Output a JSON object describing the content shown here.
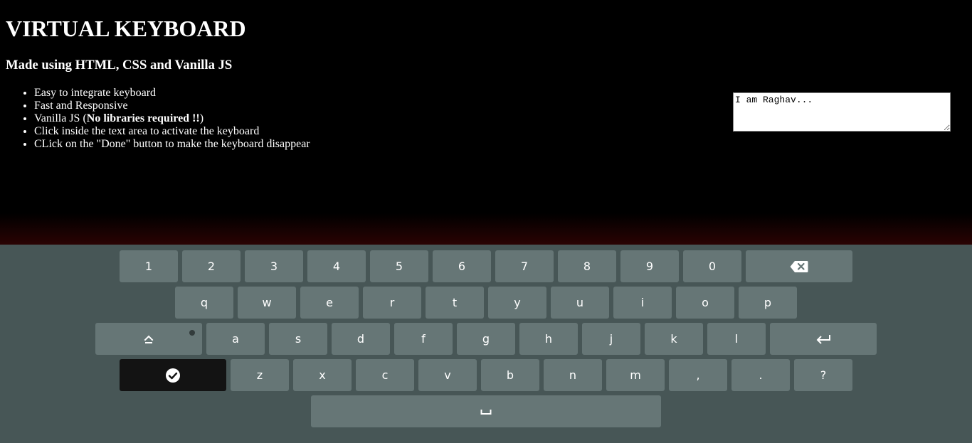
{
  "page": {
    "title": "VIRTUAL KEYBOARD",
    "subtitle": "Made using HTML, CSS and Vanilla JS",
    "features": [
      "Easy to integrate keyboard",
      "Fast and Responsive",
      "Click inside the text area to activate the keyboard",
      "CLick on the \"Done\" button to make the keyboard disappear"
    ],
    "vanilla_feature": {
      "prefix": "Vanilla JS (",
      "bold": "No libraries required !!",
      "suffix": ")"
    }
  },
  "textarea": {
    "value": "I am Raghav..."
  },
  "keyboard": {
    "row1": [
      "1",
      "2",
      "3",
      "4",
      "5",
      "6",
      "7",
      "8",
      "9",
      "0"
    ],
    "row2": [
      "q",
      "w",
      "e",
      "r",
      "t",
      "y",
      "u",
      "i",
      "o",
      "p"
    ],
    "row3": [
      "a",
      "s",
      "d",
      "f",
      "g",
      "h",
      "j",
      "k",
      "l"
    ],
    "row4": [
      "z",
      "x",
      "c",
      "v",
      "b",
      "n",
      "m",
      ",",
      ".",
      "?"
    ],
    "special_keys": {
      "backspace": "backspace-icon",
      "caps_lock": "caps-lock-icon",
      "enter": "enter-icon",
      "done": "check-circle-icon",
      "space": "space-icon"
    },
    "colors": {
      "background": "#475656",
      "key": "#667676",
      "done_key": "#131313",
      "key_text": "#ffffff"
    }
  }
}
